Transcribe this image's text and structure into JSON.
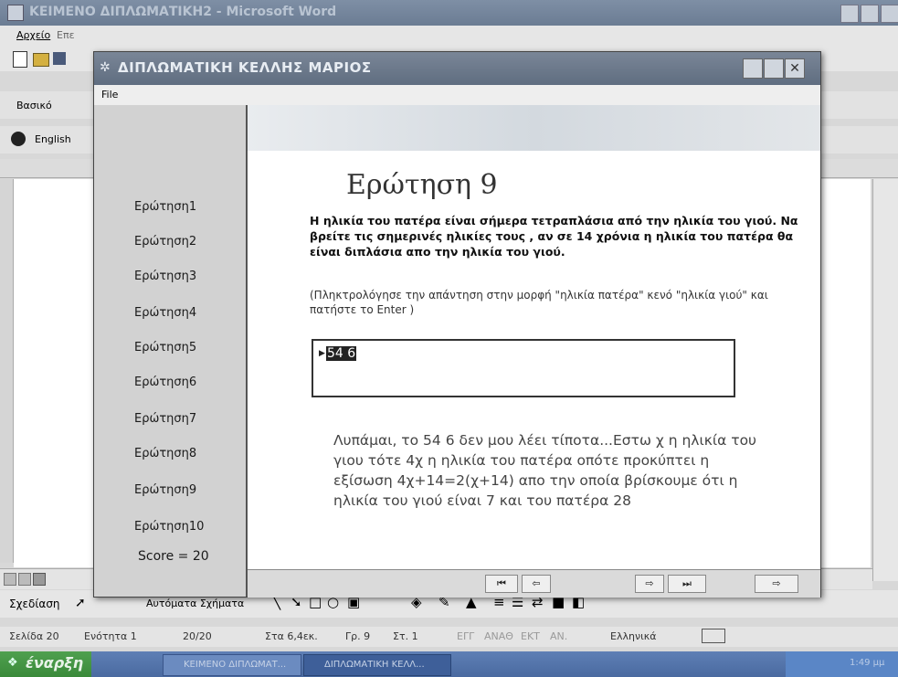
{
  "word": {
    "title": "ΚΕΙΜΕΝΟ ΔΙΠΛΩΜΑΤΙΚΗ2 - Microsoft Word",
    "menu_file": "Αρχείο",
    "menu_edit": "Επε",
    "style_box": "Βασικό",
    "lang_box": "English",
    "draw_label": "Σχεδίαση",
    "autoshapes_label": "Αυτόματα Σχήματα",
    "status": {
      "page": "Σελίδα 20",
      "section": "Ενότητα 1",
      "pages": "20/20",
      "at": "Στα 6,4εκ.",
      "line": "Γρ. 9",
      "col": "Στ. 1",
      "rec": "ΕΓΓ",
      "trk": "ΑΝΑΘ",
      "ext": "ΕΚΤ",
      "ovr": "ΑΝ.",
      "language": "Ελληνικά"
    },
    "taskbar": {
      "start": "έναρξη",
      "task1": "ΚΕΙΜΕΝΟ ΔΙΠΛΩΜΑΤ...",
      "task2": "ΔΙΠΛΩΜΑΤΙΚΗ ΚΕΛΛ...",
      "clock": "1:49 μμ"
    }
  },
  "app": {
    "title": "ΔΙΠΛΩΜΑΤΙΚΗ  ΚΕΛΛΗΣ ΜΑΡΙΟΣ",
    "menu_file": "File",
    "questions": [
      "Ερώτηση1",
      "Ερώτηση2",
      "Ερώτηση3",
      "Ερώτηση4",
      "Ερώτηση5",
      "Ερώτηση6",
      "Ερώτηση7",
      "Ερώτηση8",
      "Ερώτηση9",
      "Ερώτηση10"
    ],
    "score": "Score = 20",
    "heading": "Ερώτηση 9",
    "question_text": "Η ηλικία του πατέρα  είναι σήμερα τετραπλάσια από την  ηλικία του γιού. Να βρείτε τις σημερινές ηλικίες τους , αν σε 14 χρόνια η ηλικία του πατέρα θα είναι διπλάσια απο την ηλικία του γιού.",
    "instruction": "(Πληκτρολόγησε την απάντηση στην μορφή \"ηλικία πατέρα\" κενό \"ηλικία γιού\" και πατήστε το Enter )",
    "answer_value": "54 6",
    "feedback": "Λυπάμαι, το 54 6 δεν μου λέει τίποτα...Εστω χ η ηλικία του γιου τότε 4χ η ηλικία του πατέρα οπότε προκύπτει η εξίσωση 4χ+14=2(χ+14) απο την οποία βρίσκουμε ότι η ηλικία του γιού είναι 7 και του πατέρα 28"
  }
}
